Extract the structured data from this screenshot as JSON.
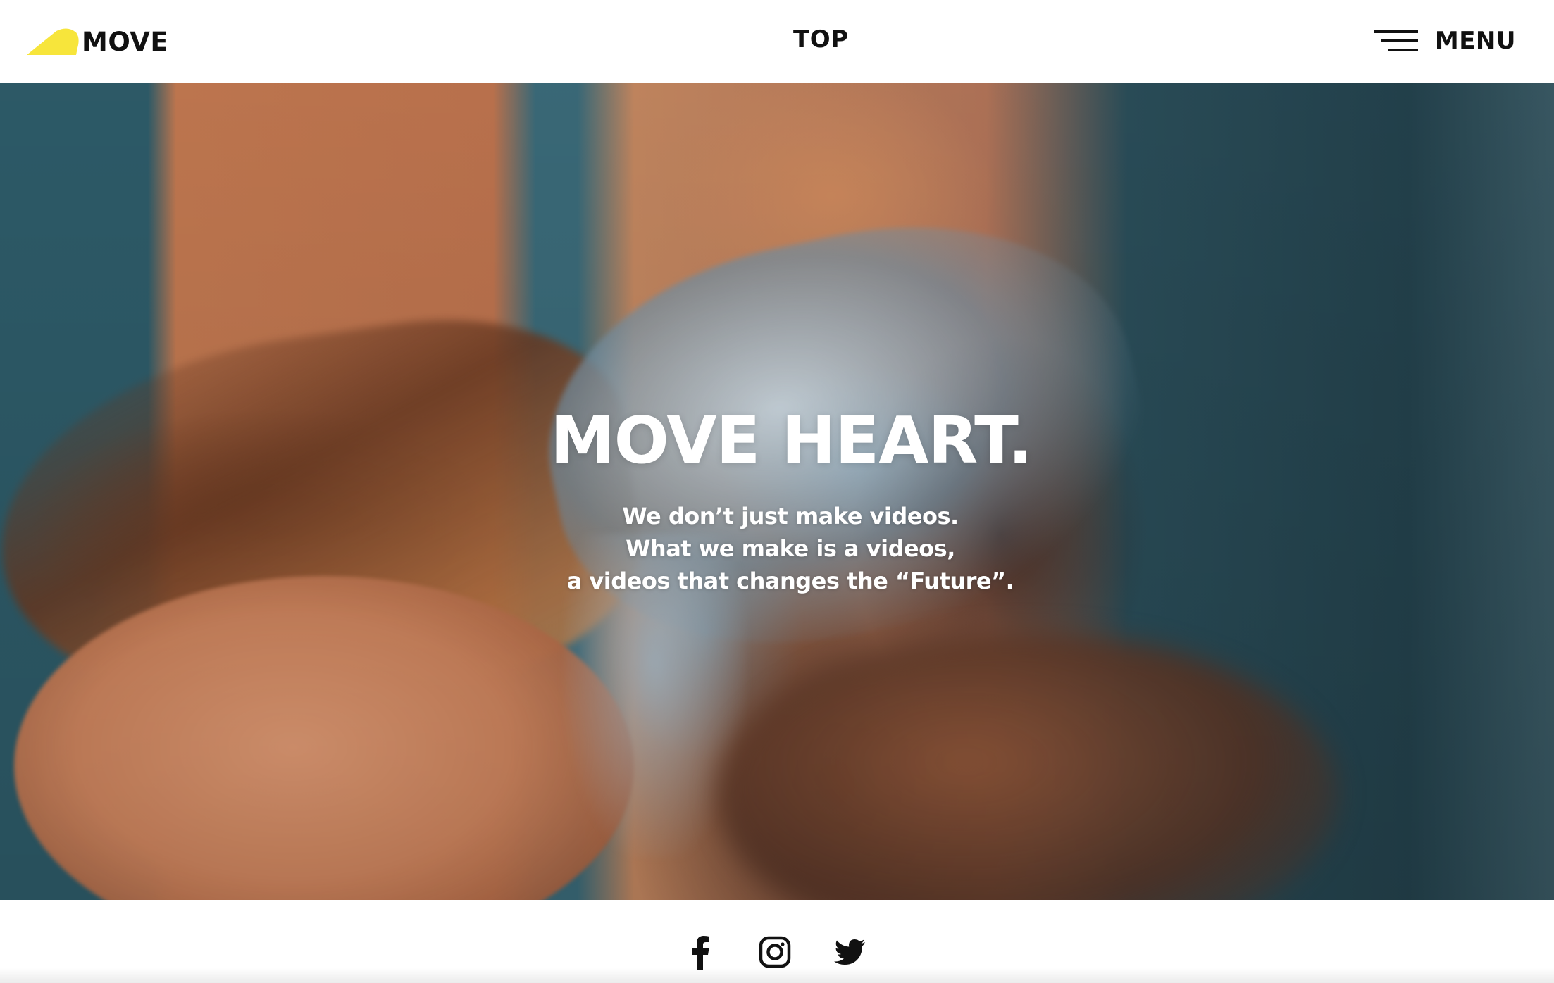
{
  "header": {
    "logo_text": "MOVE",
    "nav_current": "TOP",
    "menu_label": "MENU"
  },
  "hero": {
    "title": "MOVE HEART.",
    "lines": [
      "We don’t just make videos.",
      "What we make is a videos,",
      "a videos that changes the “Future”."
    ]
  },
  "social": {
    "icons": [
      "facebook-icon",
      "instagram-icon",
      "twitter-icon"
    ]
  },
  "colors": {
    "brand_yellow": "#f7e53b",
    "text_dark": "#111111",
    "hero_text": "#ffffff"
  }
}
